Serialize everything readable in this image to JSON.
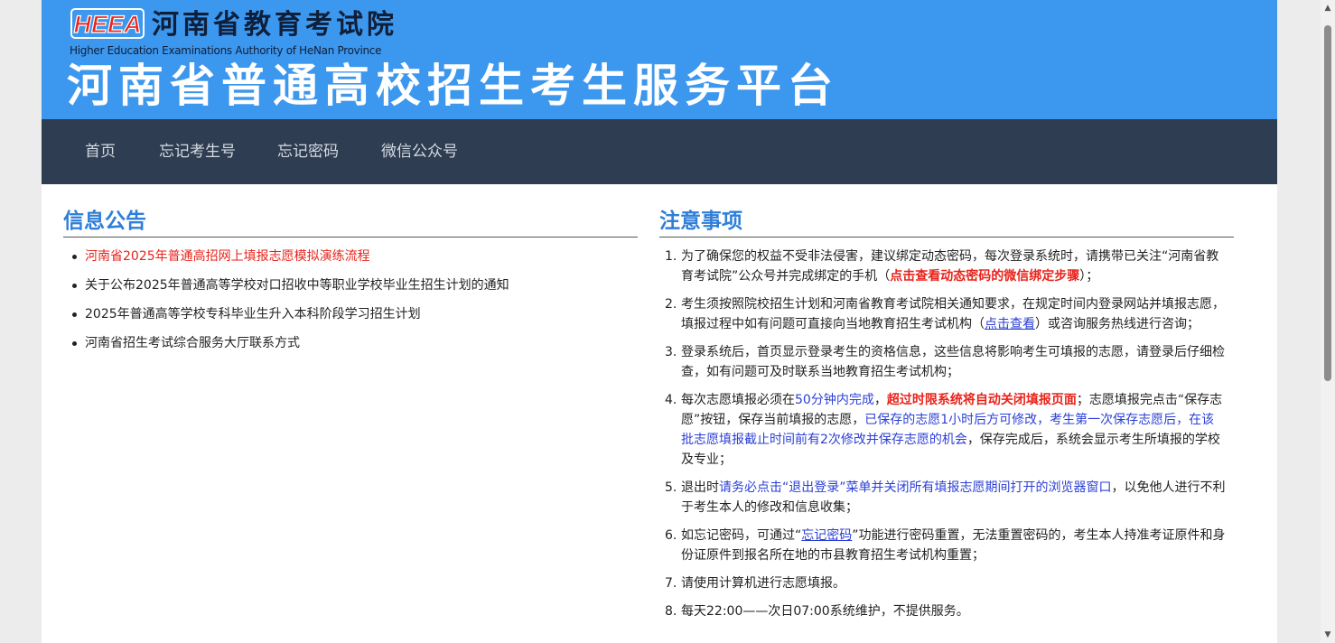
{
  "header": {
    "logo_text": "HEEA",
    "org_name_cn": "河南省教育考试院",
    "org_name_en": "Higher Education Examinations Authority of HeNan Province",
    "site_title": "河南省普通高校招生考生服务平台"
  },
  "nav": {
    "items": [
      {
        "label": "首页"
      },
      {
        "label": "忘记考生号"
      },
      {
        "label": "忘记密码"
      },
      {
        "label": "微信公众号"
      }
    ]
  },
  "announcements": {
    "title": "信息公告",
    "items": [
      {
        "text": "河南省2025年普通高招网上填报志愿模拟演练流程",
        "highlight": true
      },
      {
        "text": "关于公布2025年普通高等学校对口招收中等职业学校毕业生招生计划的通知",
        "highlight": false
      },
      {
        "text": "2025年普通高等学校专科毕业生升入本科阶段学习招生计划",
        "highlight": false
      },
      {
        "text": "河南省招生考试综合服务大厅联系方式",
        "highlight": false
      }
    ]
  },
  "notices": {
    "title": "注意事项",
    "items": [
      {
        "num": "1.",
        "parts": [
          {
            "t": "为了确保您的权益不受非法侵害，建议绑定动态密码，每次登录系统时，请携带已关注“河南省教育考试院”公众号并完成绑定的手机（",
            "s": ""
          },
          {
            "t": "点击查看动态密码的微信绑定步骤",
            "s": "red-b"
          },
          {
            "t": "）；",
            "s": ""
          }
        ]
      },
      {
        "num": "2.",
        "parts": [
          {
            "t": "考生须按照院校招生计划和河南省教育考试院相关通知要求，在规定时间内登录网站并填报志愿，填报过程中如有问题可直接向当地教育招生考试机构（",
            "s": ""
          },
          {
            "t": "点击查看",
            "s": "link"
          },
          {
            "t": "）或咨询服务热线进行咨询；",
            "s": ""
          }
        ]
      },
      {
        "num": "3.",
        "parts": [
          {
            "t": "登录系统后，首页显示登录考生的资格信息，这些信息将影响考生可填报的志愿，请登录后仔细检查，如有问题可及时联系当地教育招生考试机构；",
            "s": ""
          }
        ]
      },
      {
        "num": "4.",
        "parts": [
          {
            "t": "每次志愿填报必须在",
            "s": ""
          },
          {
            "t": "50分钟内完成",
            "s": "blue"
          },
          {
            "t": "，",
            "s": ""
          },
          {
            "t": "超过时限系统将自动关闭填报页面",
            "s": "red-b"
          },
          {
            "t": "；志愿填报完点击“保存志愿”按钮，保存当前填报的志愿，",
            "s": ""
          },
          {
            "t": "已保存的志愿1小时后方可修改，考生第一次保存志愿后，在该批志愿填报截止时间前有2次修改并保存志愿的机会",
            "s": "blue"
          },
          {
            "t": "，保存完成后，系统会显示考生所填报的学校及专业；",
            "s": ""
          }
        ]
      },
      {
        "num": "5.",
        "parts": [
          {
            "t": "退出时",
            "s": ""
          },
          {
            "t": "请务必点击“退出登录”菜单并关闭所有填报志愿期间打开的浏览器窗口",
            "s": "blue"
          },
          {
            "t": "，以免他人进行不利于考生本人的修改和信息收集；",
            "s": ""
          }
        ]
      },
      {
        "num": "6.",
        "parts": [
          {
            "t": "如忘记密码，可通过“",
            "s": ""
          },
          {
            "t": "忘记密码",
            "s": "link"
          },
          {
            "t": "”功能进行密码重置，无法重置密码的，考生本人持准考证原件和身份证原件到报名所在地的市县教育招生考试机构重置；",
            "s": ""
          }
        ]
      },
      {
        "num": "7.",
        "parts": [
          {
            "t": "请使用计算机进行志愿填报。",
            "s": ""
          }
        ]
      },
      {
        "num": "8.",
        "parts": [
          {
            "t": "每天22:00——次日07:00系统维护，不提供服务。",
            "s": ""
          }
        ]
      }
    ]
  },
  "colors": {
    "banner": "#3c97ee",
    "navbar": "#2e3d51",
    "section_title": "#2f7ed8",
    "highlight_red": "#e8231b",
    "highlight_blue": "#2b3fd6"
  }
}
